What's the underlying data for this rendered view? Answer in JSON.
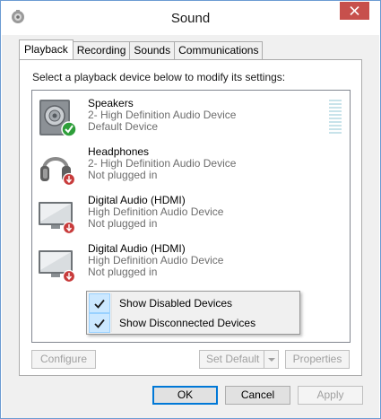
{
  "window": {
    "title": "Sound",
    "icon": "speaker-app-icon",
    "close_icon": "close-icon"
  },
  "tabs": [
    {
      "label": "Playback",
      "active": true
    },
    {
      "label": "Recording",
      "active": false
    },
    {
      "label": "Sounds",
      "active": false
    },
    {
      "label": "Communications",
      "active": false
    }
  ],
  "panel": {
    "instruction": "Select a playback device below to modify its settings:"
  },
  "devices": [
    {
      "name": "Speakers",
      "driver": "2- High Definition Audio Device",
      "status": "Default Device",
      "icon": "speakers-icon",
      "badge": "default-check-badge"
    },
    {
      "name": "Headphones",
      "driver": "2- High Definition Audio Device",
      "status": "Not plugged in",
      "icon": "headphones-icon",
      "badge": "unplugged-badge"
    },
    {
      "name": "Digital Audio (HDMI)",
      "driver": "High Definition Audio Device",
      "status": "Not plugged in",
      "icon": "monitor-icon",
      "badge": "unplugged-badge"
    },
    {
      "name": "Digital Audio (HDMI)",
      "driver": "High Definition Audio Device",
      "status": "Not plugged in",
      "icon": "monitor-icon",
      "badge": "unplugged-badge"
    }
  ],
  "context_menu": {
    "items": [
      {
        "label": "Show Disabled Devices",
        "checked": true
      },
      {
        "label": "Show Disconnected Devices",
        "checked": true
      }
    ]
  },
  "buttons": {
    "configure": "Configure",
    "set_default": "Set Default",
    "properties": "Properties",
    "ok": "OK",
    "cancel": "Cancel",
    "apply": "Apply"
  },
  "colors": {
    "accent": "#0078d7",
    "close": "#c7504c",
    "check_green": "#2e9e3a",
    "unplugged_red": "#c83b3b",
    "menu_highlight": "#cce8ff"
  }
}
